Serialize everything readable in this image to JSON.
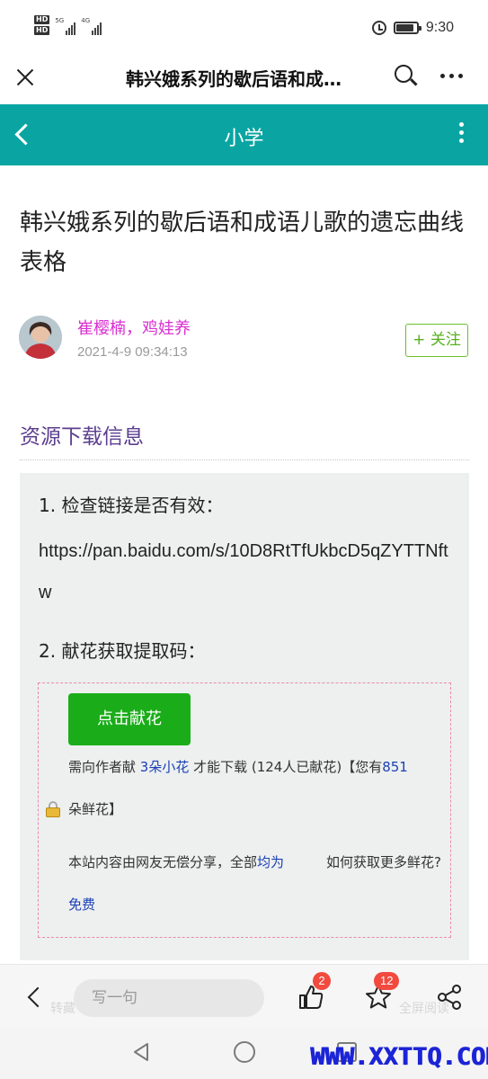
{
  "status_bar": {
    "hd1": "HD",
    "hd2": "HD",
    "net1": "5G",
    "net2": "4G",
    "time": "9:30"
  },
  "browser_bar": {
    "title": "韩兴娥系列的歇后语和成…"
  },
  "nav": {
    "title": "小学"
  },
  "article": {
    "title": "韩兴娥系列的歇后语和成语儿歌的遗忘曲线表格",
    "author": "崔樱楠，鸡娃养",
    "date": "2021-4-9 09:34:13",
    "follow_label": "+ 关注"
  },
  "resource": {
    "section_title": "资源下载信息",
    "step1": "1. 检查链接是否有效：",
    "link": "https://pan.baidu.com/s/10D8RtTfUkbcD5qZYTTNftw",
    "step2": "2. 献花获取提取码：",
    "button": "点击献花",
    "need_prefix": "需向作者献 ",
    "need_flowers": "3朵小花",
    "need_suffix": " 才能下载 (124人已献花)【您有",
    "have_count": "851",
    "need_end": "朵鲜花】",
    "share_text": "本站内容由网友无偿分享，全部",
    "share_link": "均为",
    "howto": "如何获取更多鲜花?",
    "free": "免费"
  },
  "bottom_bar": {
    "comment_placeholder": "写一句",
    "like_count": "2",
    "fav_count": "12",
    "bg_text_left": "转藏",
    "bg_text_right": "全屏阅读"
  },
  "watermark": "WWW.XXTTQ.COM",
  "colors": {
    "nav_bg": "#0aa5a2",
    "author": "#d92ed0",
    "follow": "#58b01d",
    "section_title": "#5b3e8f",
    "button": "#1aad19",
    "link": "#1c3fb5",
    "badge": "#f24a3f",
    "watermark": "#1b24d6"
  }
}
